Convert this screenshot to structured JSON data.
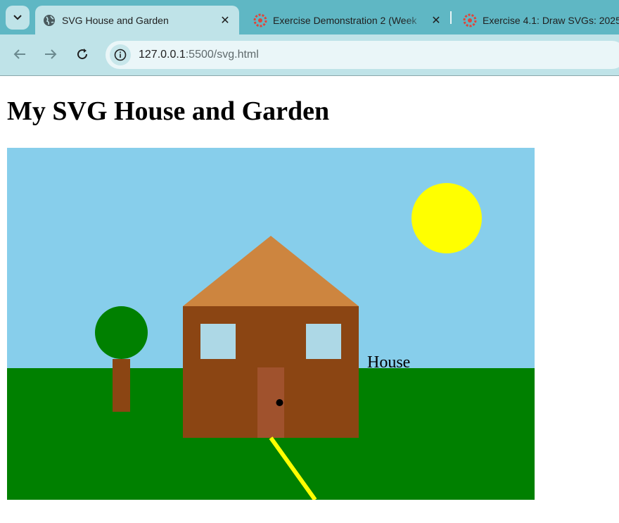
{
  "browser": {
    "tabs": [
      {
        "title": "SVG House and Garden",
        "active": true,
        "favicon": "globe-icon"
      },
      {
        "title": "Exercise Demonstration 2 (Week",
        "active": false,
        "favicon": "lms-logo-icon"
      },
      {
        "title": "Exercise 4.1: Draw SVGs: 2025",
        "active": false,
        "favicon": "lms-logo-icon"
      }
    ],
    "address_bar": {
      "host": "127.0.0.1",
      "path": ":5500/svg.html"
    }
  },
  "page": {
    "heading": "My SVG House and Garden",
    "scene": {
      "label": "House",
      "colors": {
        "sky": "#87CEEB",
        "grass": "#008000",
        "sun": "#FFFF00",
        "roof": "#CD853F",
        "house_wall": "#8B4513",
        "window": "#ADD8E6",
        "door": "#A0522D",
        "doorknob": "#000000",
        "tree_trunk": "#8B4513",
        "tree_top": "#008000",
        "path": "#FFFF00"
      }
    }
  }
}
